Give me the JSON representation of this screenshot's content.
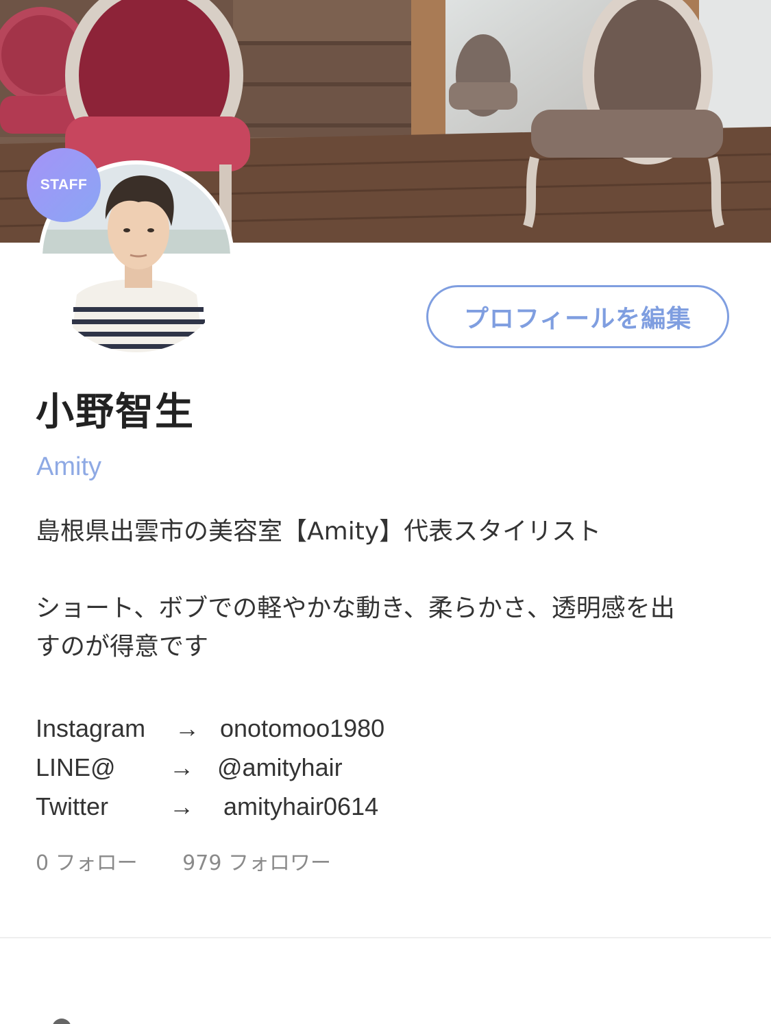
{
  "profile": {
    "badge": "STAFF",
    "name": "小野智生",
    "shop": "Amity",
    "edit_button": "プロフィールを編集",
    "bio": {
      "line1": "島根県出雲市の美容室【Amity】代表スタイリスト",
      "line2": "ショート、ボブでの軽やかな動き、柔らかさ、透明感を出",
      "line3": "すのが得意です"
    },
    "links": [
      {
        "label": "Instagram",
        "arrow": "→",
        "value": "onotomoo1980"
      },
      {
        "label": "LINE@",
        "arrow": "→",
        "value": "@amityhair"
      },
      {
        "label": "Twitter",
        "arrow": "→",
        "value": "amityhair0614"
      }
    ],
    "following": "0 フォロー",
    "followers": "979 フォロワー"
  },
  "colors": {
    "accent": "#7f9ee0",
    "shop": "#8ea9e4",
    "badge_start": "#a493f7",
    "badge_end": "#8aa6f4"
  },
  "icons": {
    "cover": "salon-interior-photo",
    "avatar": "profile-photo"
  }
}
